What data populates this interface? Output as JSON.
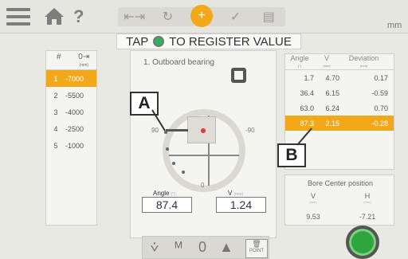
{
  "topbar": {
    "icons": [
      "menu-icon",
      "home-icon",
      "help-icon"
    ],
    "help_label": "?",
    "unit": "mm"
  },
  "steps": [
    {
      "icon": "dimensions-icon",
      "label": "⇤⇥"
    },
    {
      "icon": "rotation-icon",
      "label": "↻"
    },
    {
      "icon": "measure-icon",
      "label": "+"
    },
    {
      "icon": "result-icon",
      "label": "✓"
    },
    {
      "icon": "save-icon",
      "label": "▤"
    }
  ],
  "instruction": {
    "prefix": "TAP",
    "suffix": "TO REGISTER VALUE"
  },
  "points_table": {
    "headers": [
      "#",
      "0⇥",
      "(mm)"
    ],
    "rows": [
      {
        "num": "1",
        "value": "-7000"
      },
      {
        "num": "2",
        "value": "-5500"
      },
      {
        "num": "3",
        "value": "-4000"
      },
      {
        "num": "4",
        "value": "-2500"
      },
      {
        "num": "5",
        "value": "-1000"
      }
    ]
  },
  "measurement": {
    "title": "1. Outboard bearing",
    "dial_labels": {
      "left": "90",
      "right": "-90",
      "bottom": "0"
    },
    "angle_label": "Angle",
    "angle_unit": "(°)",
    "angle_value": "87.4",
    "v_label": "V",
    "v_unit": "(mm)",
    "v_value": "1.24"
  },
  "results_table": {
    "headers": [
      {
        "label": "Angle",
        "unit": "(°)"
      },
      {
        "label": "V",
        "unit": "(mm)"
      },
      {
        "label": "Deviation",
        "unit": "(mm)"
      }
    ],
    "rows": [
      [
        "1.7",
        "4.70",
        "0.17"
      ],
      [
        "36.4",
        "6.15",
        "-0.59"
      ],
      [
        "63.0",
        "6.24",
        "0.70"
      ],
      [
        "87.3",
        "2.15",
        "-0.28"
      ]
    ]
  },
  "bore_center": {
    "title": "Bore Center position",
    "v_label": "V",
    "h_label": "H",
    "unit": "(mm)",
    "v_value": "9.53",
    "h_value": "-7.21"
  },
  "callouts": [
    "A",
    "B"
  ],
  "bottom_bar": {
    "items": [
      "⩒",
      "ᴹ",
      "0",
      "▲"
    ],
    "point_label": "POINT"
  }
}
